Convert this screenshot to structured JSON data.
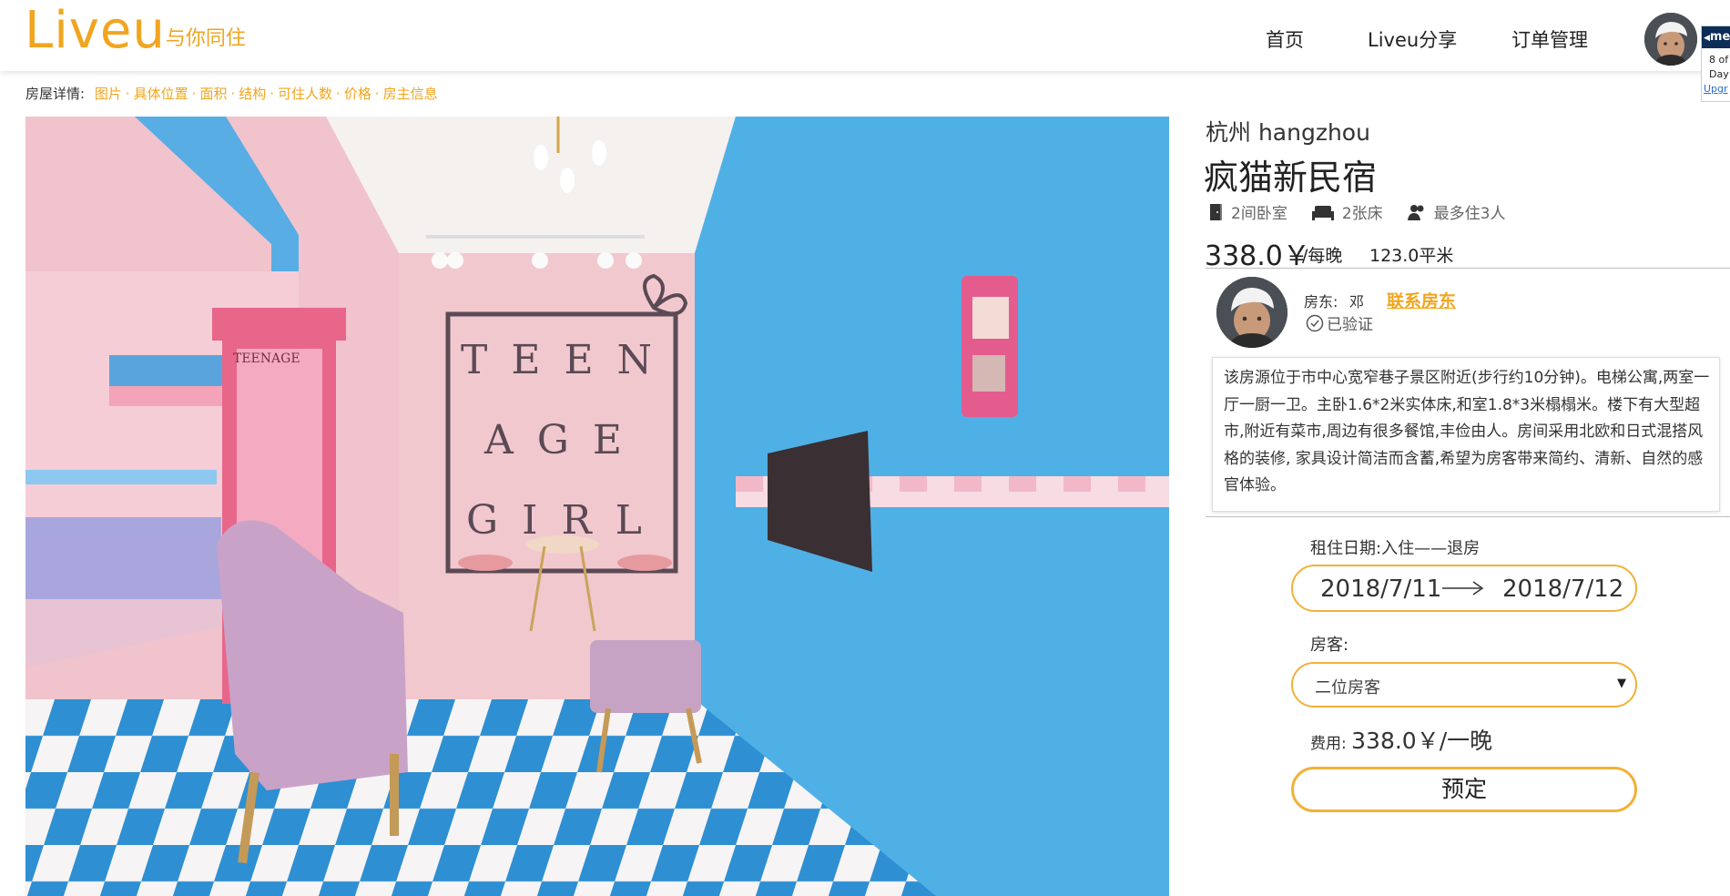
{
  "header": {
    "logo_main": "Liveu",
    "logo_sub": "与你同住",
    "nav": [
      "首页",
      "Liveu分享",
      "订单管理"
    ],
    "popup": {
      "tag": "me",
      "line1": "8 of",
      "line2": "Day",
      "line3": "Upgr"
    }
  },
  "detail": {
    "label": "房屋详情:",
    "links": [
      "图片",
      "具体位置",
      "面积",
      "结构",
      "可住人数",
      "价格",
      "房主信息"
    ],
    "separator": "·"
  },
  "photo": {
    "wall_text": [
      "T E E N",
      "A G E",
      "G I R L"
    ],
    "phonebooth_text": "TEENAGE"
  },
  "listing": {
    "city": "杭州 hangzhou",
    "title": "疯猫新民宿",
    "features": [
      {
        "icon": "door-icon",
        "label": "2间卧室"
      },
      {
        "icon": "bed-icon",
        "label": "2张床"
      },
      {
        "icon": "people-icon",
        "label": "最多住3人"
      }
    ],
    "price": "338.0￥",
    "price_unit": "/每晚",
    "area": "123.0平米"
  },
  "host": {
    "label": "房东:",
    "name": "邓",
    "contact": "联系房东",
    "verified": "已验证"
  },
  "description": "该房源位于市中心宽窄巷子景区附近(步行约10分钟)。电梯公寓,两室一厅一厨一卫。主卧1.6*2米实体床,和室1.8*3米榻榻米。楼下有大型超市,附近有菜市,周边有很多餐馆,丰俭由人。房间采用北欧和日式混搭风格的装修,  家具设计简洁而含蓄,希望为房客带来简约、清新、自然的感官体验。",
  "booking": {
    "rent_label": "租住日期:入住——退房",
    "checkin": "2018/7/11",
    "checkout": "2018/7/12",
    "guest_label": "房客:",
    "guest_value": "二位房客",
    "fee_label": "费用:",
    "fee_value": "338.0￥/一晚",
    "book_label": "预定"
  },
  "colors": {
    "accent": "#f1a51f",
    "border_accent": "#f1b13a"
  }
}
